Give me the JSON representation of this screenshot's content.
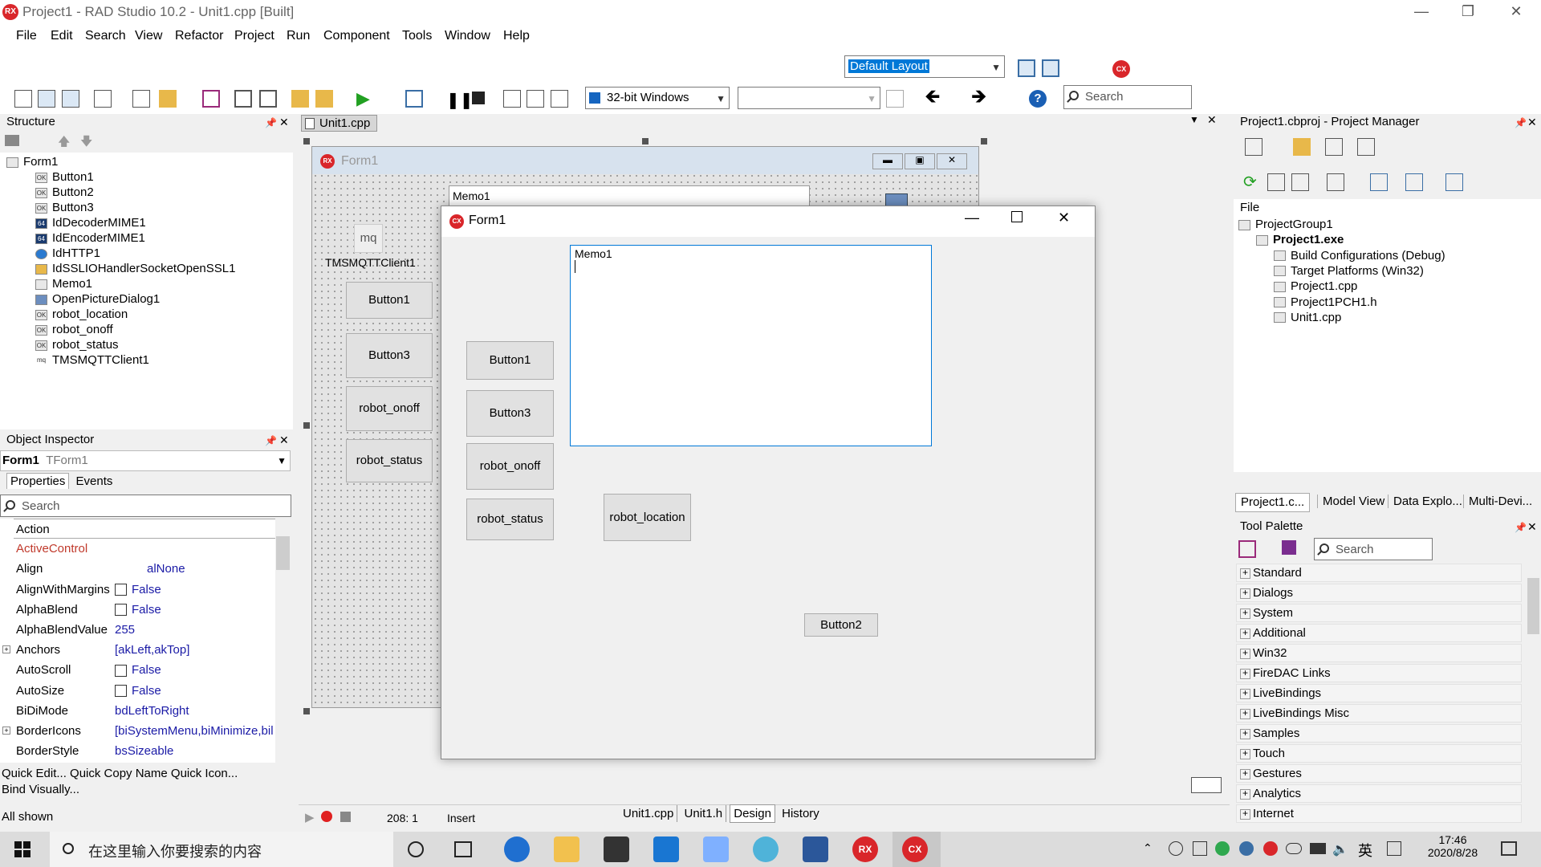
{
  "window": {
    "title": "Project1 - RAD Studio 10.2 - Unit1.cpp [Built]",
    "logo_text": "RX"
  },
  "menu": {
    "items": [
      "File",
      "Edit",
      "Search",
      "View",
      "Refactor",
      "Project",
      "Run",
      "Component",
      "Tools",
      "Window",
      "Help"
    ]
  },
  "toolbar": {
    "layout_combo": "Default Layout",
    "platform_combo": "32-bit Windows",
    "config_combo": "",
    "search_placeholder": "Search"
  },
  "structure": {
    "title": "Structure",
    "items": [
      {
        "label": "Form1",
        "icon": "form-icon",
        "level": 0
      },
      {
        "label": "Button1",
        "icon": "ok-icon",
        "level": 1
      },
      {
        "label": "Button2",
        "icon": "ok-icon",
        "level": 1
      },
      {
        "label": "Button3",
        "icon": "ok-icon",
        "level": 1
      },
      {
        "label": "IdDecoderMIME1",
        "icon": "64-icon",
        "level": 1
      },
      {
        "label": "IdEncoderMIME1",
        "icon": "64-icon",
        "level": 1
      },
      {
        "label": "IdHTTP1",
        "icon": "globe-icon",
        "level": 1
      },
      {
        "label": "IdSSLIOHandlerSocketOpenSSL1",
        "icon": "lock-icon",
        "level": 1
      },
      {
        "label": "Memo1",
        "icon": "memo-icon",
        "level": 1
      },
      {
        "label": "OpenPictureDialog1",
        "icon": "picture-icon",
        "level": 1
      },
      {
        "label": "robot_location",
        "icon": "ok-icon",
        "level": 1
      },
      {
        "label": "robot_onoff",
        "icon": "ok-icon",
        "level": 1
      },
      {
        "label": "robot_status",
        "icon": "ok-icon",
        "level": 1
      },
      {
        "label": "TMSMQTTClient1",
        "icon": "mq-icon",
        "level": 1
      }
    ]
  },
  "object_inspector": {
    "title": "Object Inspector",
    "selected_name": "Form1",
    "selected_type": "TForm1",
    "tab_properties": "Properties",
    "tab_events": "Events",
    "search_placeholder": "Search",
    "rows": [
      {
        "name": "Action",
        "value": "",
        "kind": "header"
      },
      {
        "name": "ActiveControl",
        "value": "",
        "kind": "ref"
      },
      {
        "name": "Align",
        "value": "alNone",
        "kind": "text"
      },
      {
        "name": "AlignWithMargins",
        "value": "False",
        "kind": "check"
      },
      {
        "name": "AlphaBlend",
        "value": "False",
        "kind": "check"
      },
      {
        "name": "AlphaBlendValue",
        "value": "255",
        "kind": "text"
      },
      {
        "name": "Anchors",
        "value": "[akLeft,akTop]",
        "kind": "expand"
      },
      {
        "name": "AutoScroll",
        "value": "False",
        "kind": "check"
      },
      {
        "name": "AutoSize",
        "value": "False",
        "kind": "check"
      },
      {
        "name": "BiDiMode",
        "value": "bdLeftToRight",
        "kind": "text"
      },
      {
        "name": "BorderIcons",
        "value": "[biSystemMenu,biMinimize,bil",
        "kind": "expand"
      },
      {
        "name": "BorderStyle",
        "value": "bsSizeable",
        "kind": "text"
      }
    ],
    "quick_links_1": "Quick Edit...  Quick Copy Name  Quick Icon...",
    "quick_links_2": "Bind Visually...",
    "status": "All shown"
  },
  "editor": {
    "tab": "Unit1.cpp",
    "design_form_title": "Form1",
    "design_form_logo": "RX",
    "memo_label": "Memo1",
    "mq_label": "mq",
    "mqtt_label": "TMSMQTTClient1",
    "design_buttons": [
      "Button1",
      "Button3",
      "robot_onoff",
      "robot_status"
    ],
    "status_position": "208:   1",
    "status_mode": "Insert",
    "bottom_tabs": [
      "Unit1.cpp",
      "Unit1.h",
      "Design",
      "History"
    ]
  },
  "running_form": {
    "title": "Form1",
    "logo_text": "CX",
    "memo_text": "Memo1",
    "buttons": {
      "button1": "Button1",
      "button3": "Button3",
      "robot_onoff": "robot_onoff",
      "robot_status": "robot_status",
      "robot_location": "robot_location",
      "button2": "Button2"
    }
  },
  "project_manager": {
    "title": "Project1.cbproj - Project Manager",
    "file_label": "File",
    "items": [
      {
        "label": "ProjectGroup1",
        "level": 0,
        "bold": false
      },
      {
        "label": "Project1.exe",
        "level": 1,
        "bold": true
      },
      {
        "label": "Build Configurations (Debug)",
        "level": 2,
        "bold": false
      },
      {
        "label": "Target Platforms (Win32)",
        "level": 2,
        "bold": false
      },
      {
        "label": "Project1.cpp",
        "level": 2,
        "bold": false
      },
      {
        "label": "Project1PCH1.h",
        "level": 2,
        "bold": false
      },
      {
        "label": "Unit1.cpp",
        "level": 2,
        "bold": false
      }
    ],
    "tabs": [
      "Project1.c...",
      "Model View",
      "Data Explo...",
      "Multi-Devi..."
    ]
  },
  "tool_palette": {
    "title": "Tool Palette",
    "search_placeholder": "Search",
    "categories": [
      "Standard",
      "Dialogs",
      "System",
      "Additional",
      "Win32",
      "FireDAC Links",
      "LiveBindings",
      "LiveBindings Misc",
      "Samples",
      "Touch",
      "Gestures",
      "Analytics",
      "Internet"
    ]
  },
  "taskbar": {
    "search_placeholder": "在这里输入你要搜索的内容",
    "time": "17:46",
    "date": "2020/8/28",
    "ime": "英"
  },
  "colors": {
    "accent_red": "#d9262a",
    "selection_blue": "#0078d7",
    "value_blue": "#1a1aa6"
  }
}
